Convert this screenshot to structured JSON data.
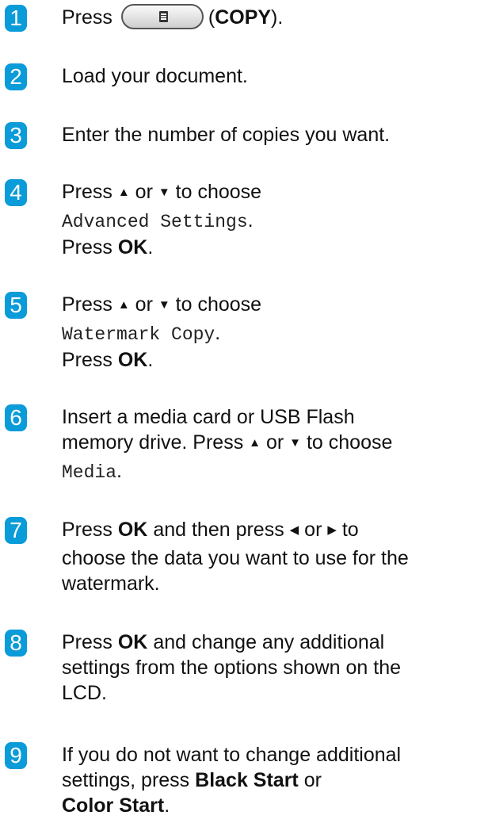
{
  "steps": [
    {
      "num": "1",
      "press": "Press",
      "copy_label": "COPY",
      "close": ")."
    },
    {
      "num": "2",
      "text": "Load your document."
    },
    {
      "num": "3",
      "text": "Enter the number of copies you want."
    },
    {
      "num": "4",
      "line1a": "Press",
      "up": "▲",
      "or": "or",
      "down": "▼",
      "line1b": "to choose",
      "menu": "Advanced Settings",
      "dot": ".",
      "press_ok_a": "Press",
      "ok": "OK",
      "press_ok_b": "."
    },
    {
      "num": "5",
      "line1a": "Press",
      "up": "▲",
      "or": "or",
      "down": "▼",
      "line1b": "to choose",
      "menu": "Watermark Copy",
      "dot": ".",
      "press_ok_a": "Press",
      "ok": "OK",
      "press_ok_b": "."
    },
    {
      "num": "6",
      "a": "Insert a media card or USB Flash",
      "b": "memory drive. Press",
      "up": "▲",
      "or": "or",
      "down": "▼",
      "c": "to choose",
      "menu": "Media",
      "dot": "."
    },
    {
      "num": "7",
      "a": "Press",
      "ok": "OK",
      "b": "and then press",
      "left": "◀",
      "or": "or",
      "right": "▶",
      "c": "to",
      "d": "choose the data you want to use for the",
      "e": "watermark."
    },
    {
      "num": "8",
      "a": "Press",
      "ok": "OK",
      "b": "and change any additional",
      "c": "settings from the options shown on the",
      "d": "LCD."
    },
    {
      "num": "9",
      "a": "If you do not want to change additional",
      "b": "settings, press",
      "black": "Black Start",
      "c": "or",
      "color": "Color Start",
      "d": "."
    }
  ],
  "colors": {
    "badge": "#0a9bd9"
  },
  "icons": {
    "copy_button": "copy-document-icon"
  }
}
